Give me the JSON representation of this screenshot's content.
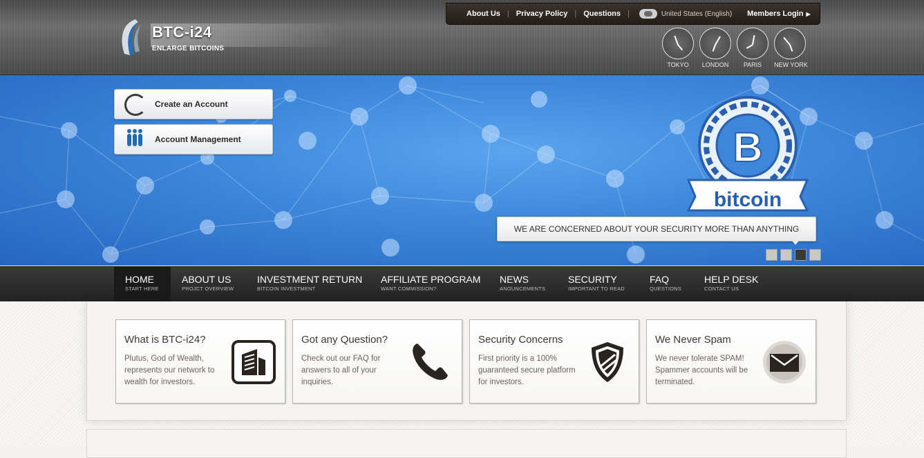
{
  "logo": {
    "title": "BTC-i24",
    "subtitle": "ENLARGE BITCOINS"
  },
  "topbar": {
    "links": [
      "About Us",
      "Privacy Policy",
      "Questions"
    ],
    "language": "United States (English)",
    "members_login": "Members Login"
  },
  "clocks": [
    "TOKYO",
    "LONDON",
    "PARIS",
    "NEW YORK"
  ],
  "banner": {
    "create_account": "Create an Account",
    "account_management": "Account Management",
    "coin_label": "bitcoin",
    "coin_symbol": "B",
    "slogan": "WE ARE CONCERNED ABOUT YOUR SECURITY MORE THAN ANYTHING",
    "slide_count": 4,
    "active_slide": 3
  },
  "nav": [
    {
      "label": "HOME",
      "sub": "START HERE"
    },
    {
      "label": "ABOUT US",
      "sub": "PROJCT OVERVIEW"
    },
    {
      "label": "INVESTMENT RETURN",
      "sub": "BITCOIN INVESTMENT"
    },
    {
      "label": "AFFILIATE PROGRAM",
      "sub": "WANT COMMISSION?"
    },
    {
      "label": "NEWS",
      "sub": "ANOUNCEMENTS"
    },
    {
      "label": "SECURITY",
      "sub": "IMPORTANT TO READ"
    },
    {
      "label": "FAQ",
      "sub": "QUESTIONS"
    },
    {
      "label": "HELP DESK",
      "sub": "CONTACT US"
    }
  ],
  "cards": [
    {
      "title": "What is BTC-i24?",
      "body": "Plutus, God of Wealth, represents our network to wealth for investors.",
      "icon": "building-icon"
    },
    {
      "title": "Got any Question?",
      "body": "Check out our FAQ for answers to all of your inquiries.",
      "icon": "phone-icon"
    },
    {
      "title": "Security Concerns",
      "body": "First priority is a 100% guaranteed secure platform for investors.",
      "icon": "shield-icon"
    },
    {
      "title": "We Never Spam",
      "body": "We never tolerate SPAM! Spammer accounts will be terminated.",
      "icon": "mail-icon"
    }
  ],
  "colors": {
    "banner_blue": "#3c86db",
    "nav_dark": "#222222",
    "coin_blue": "#2a5fb0"
  }
}
